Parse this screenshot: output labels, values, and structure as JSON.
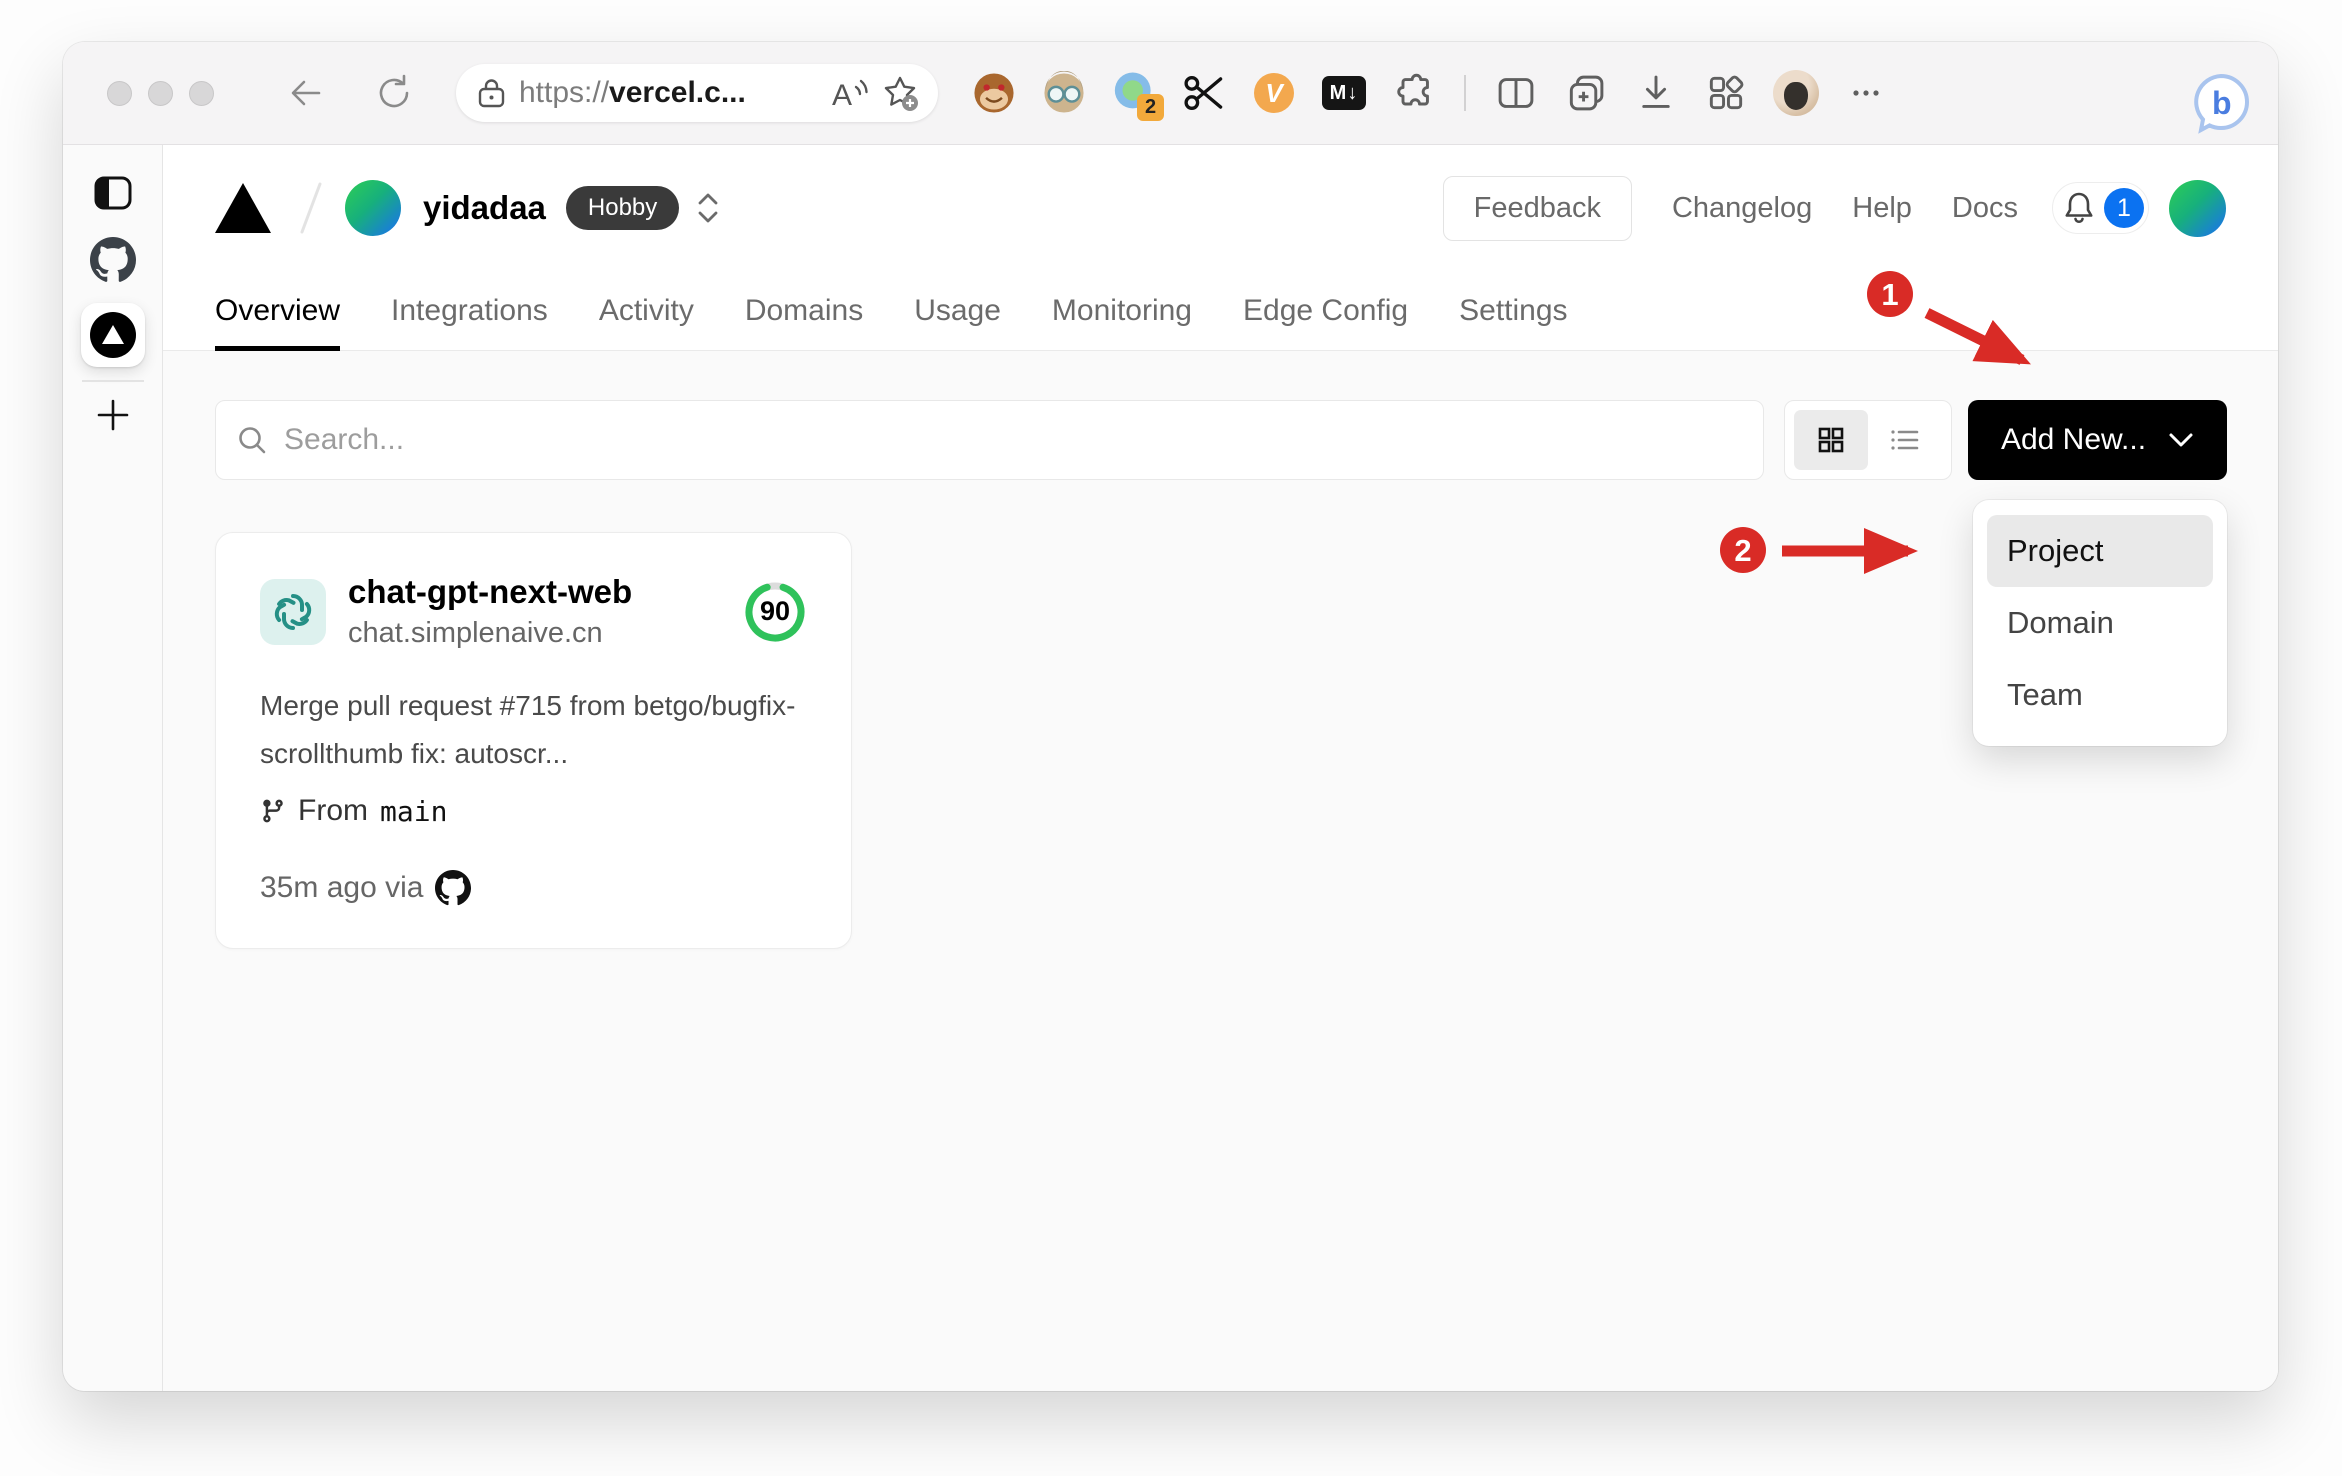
{
  "browser": {
    "url_protocol": "https://",
    "url_host": "vercel.c...",
    "proxy_badge": "2",
    "vimium_label": "V",
    "markdown_label": "M↓",
    "bing_label": "b"
  },
  "header": {
    "team": "yidadaa",
    "plan": "Hobby",
    "feedback": "Feedback",
    "links": [
      "Changelog",
      "Help",
      "Docs"
    ],
    "notif": "1"
  },
  "tabs": [
    "Overview",
    "Integrations",
    "Activity",
    "Domains",
    "Usage",
    "Monitoring",
    "Edge Config",
    "Settings"
  ],
  "active_tab": "Overview",
  "toolbar": {
    "search_placeholder": "Search...",
    "add_new": "Add New..."
  },
  "card": {
    "name": "chat-gpt-next-web",
    "domain": "chat.simplenaive.cn",
    "score": "90",
    "score_pct": 90,
    "commit": "Merge pull request #715 from betgo/bugfix-scrollthumb fix: autoscr...",
    "branch_label": "From",
    "branch": "main",
    "time": "35m ago via"
  },
  "menu": {
    "items": [
      "Project",
      "Domain",
      "Team"
    ],
    "selected": "Project"
  },
  "ann": {
    "step1": "1",
    "step2": "2",
    "color": "#d92b26"
  },
  "colors": {
    "accent_blue": "#0b72f1",
    "score_green": "#2fc25b",
    "openai_teal": "#259086"
  }
}
